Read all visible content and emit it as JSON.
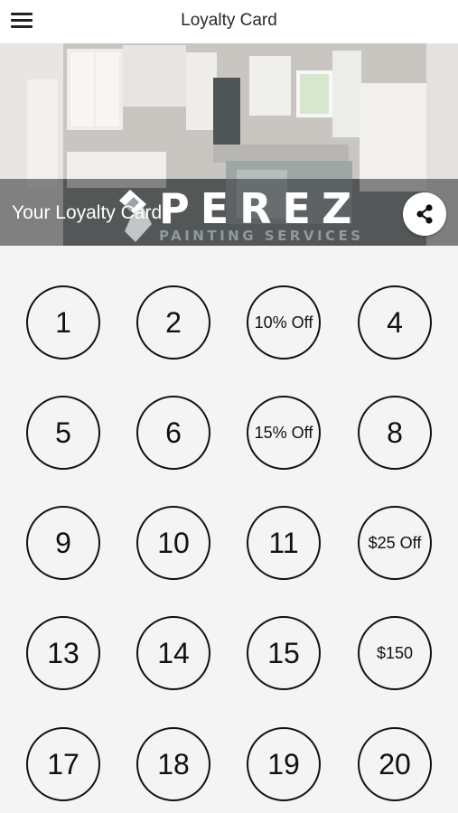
{
  "header": {
    "title": "Loyalty Card",
    "menu_icon": "hamburger-menu-icon"
  },
  "hero": {
    "logo_word": "PEREZ",
    "logo_sub": "PAINTING SERVICES",
    "label": "Your Loyalty Card",
    "share_icon": "share-icon"
  },
  "stamps": [
    {
      "label": "1",
      "reward": false
    },
    {
      "label": "2",
      "reward": false
    },
    {
      "label": "10% Off",
      "reward": true
    },
    {
      "label": "4",
      "reward": false
    },
    {
      "label": "5",
      "reward": false
    },
    {
      "label": "6",
      "reward": false
    },
    {
      "label": "15% Off",
      "reward": true
    },
    {
      "label": "8",
      "reward": false
    },
    {
      "label": "9",
      "reward": false
    },
    {
      "label": "10",
      "reward": false
    },
    {
      "label": "11",
      "reward": false
    },
    {
      "label": "$25 Off",
      "reward": true
    },
    {
      "label": "13",
      "reward": false
    },
    {
      "label": "14",
      "reward": false
    },
    {
      "label": "15",
      "reward": false
    },
    {
      "label": "$150",
      "reward": true
    },
    {
      "label": "17",
      "reward": false
    },
    {
      "label": "18",
      "reward": false
    },
    {
      "label": "19",
      "reward": false
    },
    {
      "label": "20",
      "reward": false
    }
  ]
}
